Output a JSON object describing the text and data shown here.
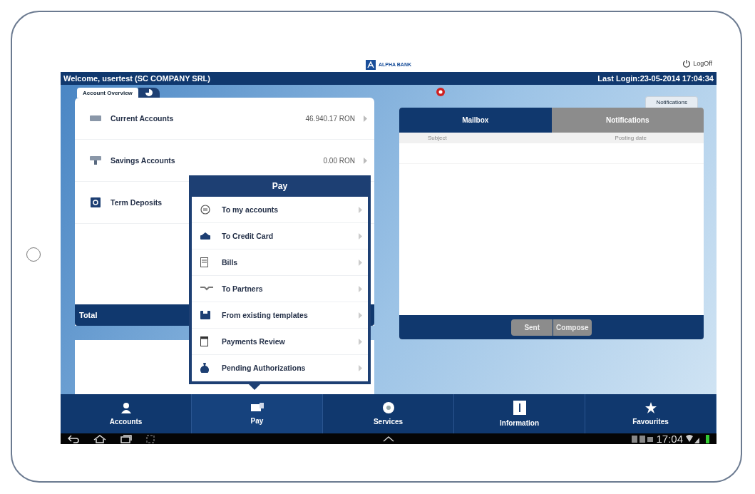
{
  "header": {
    "logo_text": "ALPHA BANK",
    "logoff": "LogOff"
  },
  "welcome": "Welcome, usertest (SC COMPANY SRL)",
  "last_login": "Last Login:23-05-2014 17:04:34",
  "overview_tab": {
    "label": "Account Overview",
    "selected": true
  },
  "notifications_tab": {
    "label": "Notifications",
    "selected": false
  },
  "accounts": [
    {
      "name": "Current Accounts",
      "amount": "46.940.17 RON"
    },
    {
      "name": "Savings Accounts",
      "amount": "0.00 RON"
    },
    {
      "name": "Term Deposits"
    }
  ],
  "total_label": "Total",
  "mail_tabs": [
    {
      "label": "Mailbox",
      "selected": true
    },
    {
      "label": "Notifications",
      "selected": false
    }
  ],
  "mail_columns": [
    "Subject",
    "Posting date"
  ],
  "mail_buttons": [
    "Sent",
    "Compose"
  ],
  "pay_menu": {
    "title": "Pay",
    "items": [
      "To my accounts",
      "To Credit Card",
      "Bills",
      "To Partners",
      "From existing templates",
      "Payments Review",
      "Pending Authorizations"
    ]
  },
  "nav": [
    {
      "label": "Accounts",
      "selected": false
    },
    {
      "label": "Pay",
      "selected": true
    },
    {
      "label": "Services",
      "selected": false
    },
    {
      "label": "Information",
      "selected": false
    },
    {
      "label": "Favourites",
      "selected": false
    }
  ],
  "status_bar": {
    "time": "17:04"
  }
}
